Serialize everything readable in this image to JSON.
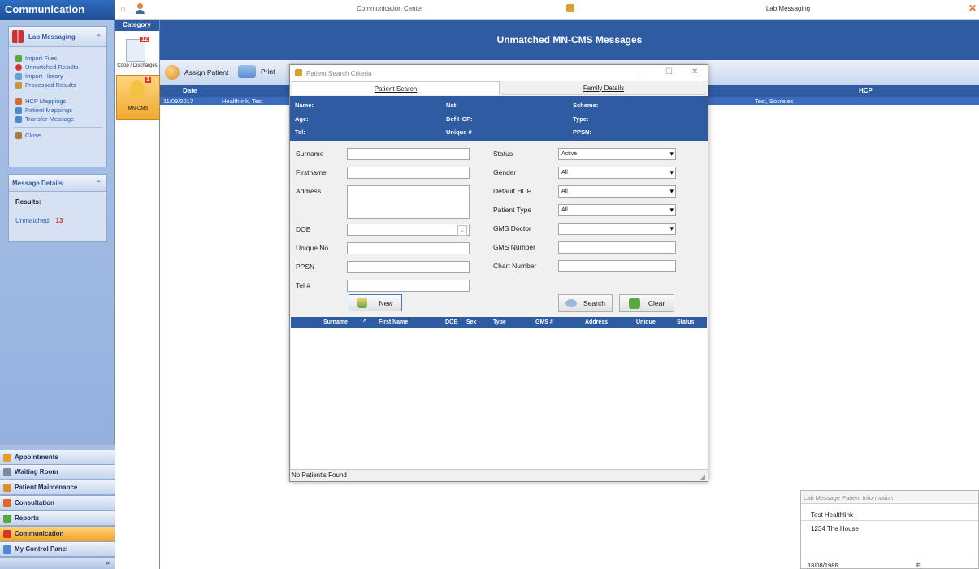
{
  "app": {
    "title": "Communication",
    "center_tab": "Communication Center",
    "right_tab": "Lab Messaging"
  },
  "sidebar": {
    "lab_panel_title": "Lab Messaging",
    "lab_links": [
      {
        "label": "Import Files",
        "icon": "import-icon",
        "color": "#5aa83c"
      },
      {
        "label": "Unmatched Results",
        "icon": "unmatched-icon",
        "color": "#d8352a"
      },
      {
        "label": "Import History",
        "icon": "history-icon",
        "color": "#6aa0d8"
      },
      {
        "label": "Processed Results",
        "icon": "processed-icon",
        "color": "#c89a30"
      },
      {
        "label": "HCP Mappings",
        "icon": "hcp-icon",
        "color": "#d86a2a"
      },
      {
        "label": "Patient Mappings",
        "icon": "patient-mappings-icon",
        "color": "#4a8ad0"
      },
      {
        "label": "Transfer Message",
        "icon": "transfer-icon",
        "color": "#4a8ad0"
      },
      {
        "label": "Close",
        "icon": "close-icon",
        "color": "#b07a30"
      }
    ],
    "details_panel_title": "Message Details",
    "results_label": "Results:",
    "unmatched_label": "Unmatched:",
    "unmatched_count": "13",
    "nav": [
      {
        "label": "Appointments",
        "color": "#e0a030"
      },
      {
        "label": "Waiting Room",
        "color": "#7a8aa0"
      },
      {
        "label": "Patient Maintenance",
        "color": "#d89030"
      },
      {
        "label": "Consultation",
        "color": "#d86a2a"
      },
      {
        "label": "Reports",
        "color": "#5aa83c"
      },
      {
        "label": "Communication",
        "color": "#d8352a",
        "active": true
      },
      {
        "label": "My Control Panel",
        "color": "#4a8ad0"
      }
    ]
  },
  "category": {
    "header": "Category",
    "items": [
      {
        "label": "Coop / Discharges",
        "badge": "12"
      },
      {
        "label": "MN-CMS",
        "badge": "1"
      }
    ]
  },
  "main": {
    "header": "Unmatched MN-CMS Messages",
    "toolbar": {
      "assign_label": "Assign Patient",
      "print_label": "Print"
    },
    "grid": {
      "date_header": "Date",
      "hcp_header": "HCP",
      "row": {
        "date": "11/09/2017",
        "name": "Healthlink, Test",
        "hcp": "Test, Socrates"
      }
    }
  },
  "dialog": {
    "title": "Patient Search Criteria",
    "tabs": [
      "Patient Search",
      "Family Details"
    ],
    "info": {
      "name": "Name:",
      "nat": "Nat:",
      "scheme": "Scheme:",
      "age": "Age:",
      "def_hcp": "Def HCP:",
      "type": "Type:",
      "tel": "Tel:",
      "unique": "Unique #",
      "ppsn": "PPSN:"
    },
    "left_fields": [
      "Surname",
      "Firstname",
      "Address",
      "DOB",
      "Unique No",
      "PPSN",
      "Tel #"
    ],
    "right_fields": [
      {
        "label": "Status",
        "value": "Active"
      },
      {
        "label": "Gender",
        "value": "All"
      },
      {
        "label": "Default HCP",
        "value": "All"
      },
      {
        "label": "Patient Type",
        "value": "All"
      },
      {
        "label": "GMS Doctor",
        "value": ""
      },
      {
        "label": "GMS Number",
        "value": ""
      },
      {
        "label": "Chart Number",
        "value": ""
      }
    ],
    "buttons": {
      "new": "New",
      "search": "Search",
      "clear": "Clear"
    },
    "result_columns": [
      "Surname",
      "First Name",
      "DOB",
      "Sex",
      "Type",
      "GMS #",
      "Address",
      "Unique",
      "Status"
    ],
    "sort_indicator": "^",
    "status": "No Patient's Found"
  },
  "info_box": {
    "title": "Lab Message Patient Information",
    "name": "Test Healthlink",
    "address": "1234 The House",
    "dob": "18/08/1986",
    "sex": "F"
  }
}
